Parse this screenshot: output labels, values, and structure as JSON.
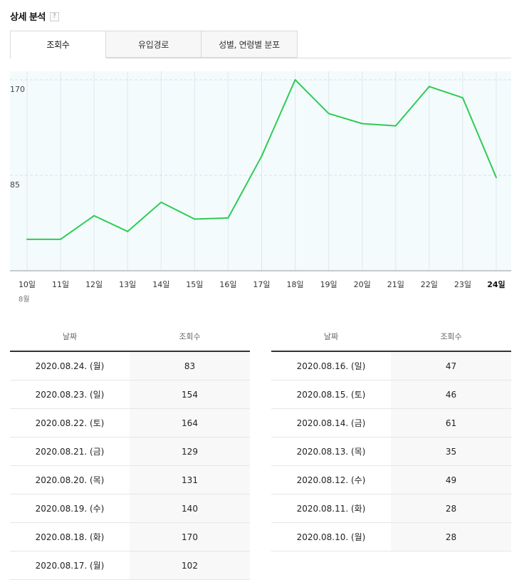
{
  "header": {
    "title": "상세 분석",
    "help_label": "?"
  },
  "tabs": [
    {
      "label": "조회수",
      "active": true
    },
    {
      "label": "유입경로",
      "active": false
    },
    {
      "label": "성별, 연령별 분포",
      "active": false
    }
  ],
  "colors": {
    "line": "#2ecc55",
    "plot_bg": "#f4fbfd",
    "grid": "#dde8ec"
  },
  "chart_data": {
    "type": "line",
    "x_month_label": "8월",
    "categories": [
      "10일",
      "11일",
      "12일",
      "13일",
      "14일",
      "15일",
      "16일",
      "17일",
      "18일",
      "19일",
      "20일",
      "21일",
      "22일",
      "23일",
      "24일"
    ],
    "highlight_category": "24일",
    "series": [
      {
        "values": [
          28,
          28,
          49,
          35,
          61,
          46,
          47,
          102,
          170,
          140,
          131,
          129,
          164,
          154,
          83
        ]
      }
    ],
    "yticks": [
      85,
      170
    ],
    "ylim": [
      0,
      170
    ],
    "grid": true,
    "legend": "none"
  },
  "table": {
    "headers": [
      "날짜",
      "조회수"
    ],
    "left_rows": [
      {
        "date": "2020.08.24. (월)",
        "views": "83"
      },
      {
        "date": "2020.08.23. (일)",
        "views": "154"
      },
      {
        "date": "2020.08.22. (토)",
        "views": "164"
      },
      {
        "date": "2020.08.21. (금)",
        "views": "129"
      },
      {
        "date": "2020.08.20. (목)",
        "views": "131"
      },
      {
        "date": "2020.08.19. (수)",
        "views": "140"
      },
      {
        "date": "2020.08.18. (화)",
        "views": "170"
      },
      {
        "date": "2020.08.17. (월)",
        "views": "102"
      }
    ],
    "right_rows": [
      {
        "date": "2020.08.16. (일)",
        "views": "47"
      },
      {
        "date": "2020.08.15. (토)",
        "views": "46"
      },
      {
        "date": "2020.08.14. (금)",
        "views": "61"
      },
      {
        "date": "2020.08.13. (목)",
        "views": "35"
      },
      {
        "date": "2020.08.12. (수)",
        "views": "49"
      },
      {
        "date": "2020.08.11. (화)",
        "views": "28"
      },
      {
        "date": "2020.08.10. (월)",
        "views": "28"
      }
    ]
  }
}
